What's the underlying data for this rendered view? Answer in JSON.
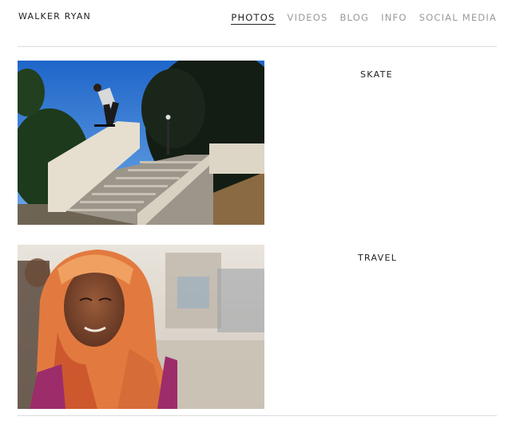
{
  "header": {
    "site_title": "WALKER RYAN",
    "nav": [
      {
        "label": "PHOTOS",
        "active": true
      },
      {
        "label": "VIDEOS",
        "active": false
      },
      {
        "label": "BLOG",
        "active": false
      },
      {
        "label": "INFO",
        "active": false
      },
      {
        "label": "SOCIAL MEDIA",
        "active": false
      }
    ]
  },
  "gallery": {
    "categories": [
      {
        "label": "SKATE"
      },
      {
        "label": "TRAVEL"
      }
    ]
  },
  "colors": {
    "text_dark": "#222222",
    "nav_inactive": "#9a9a9a",
    "divider": "#dcdcdc"
  }
}
